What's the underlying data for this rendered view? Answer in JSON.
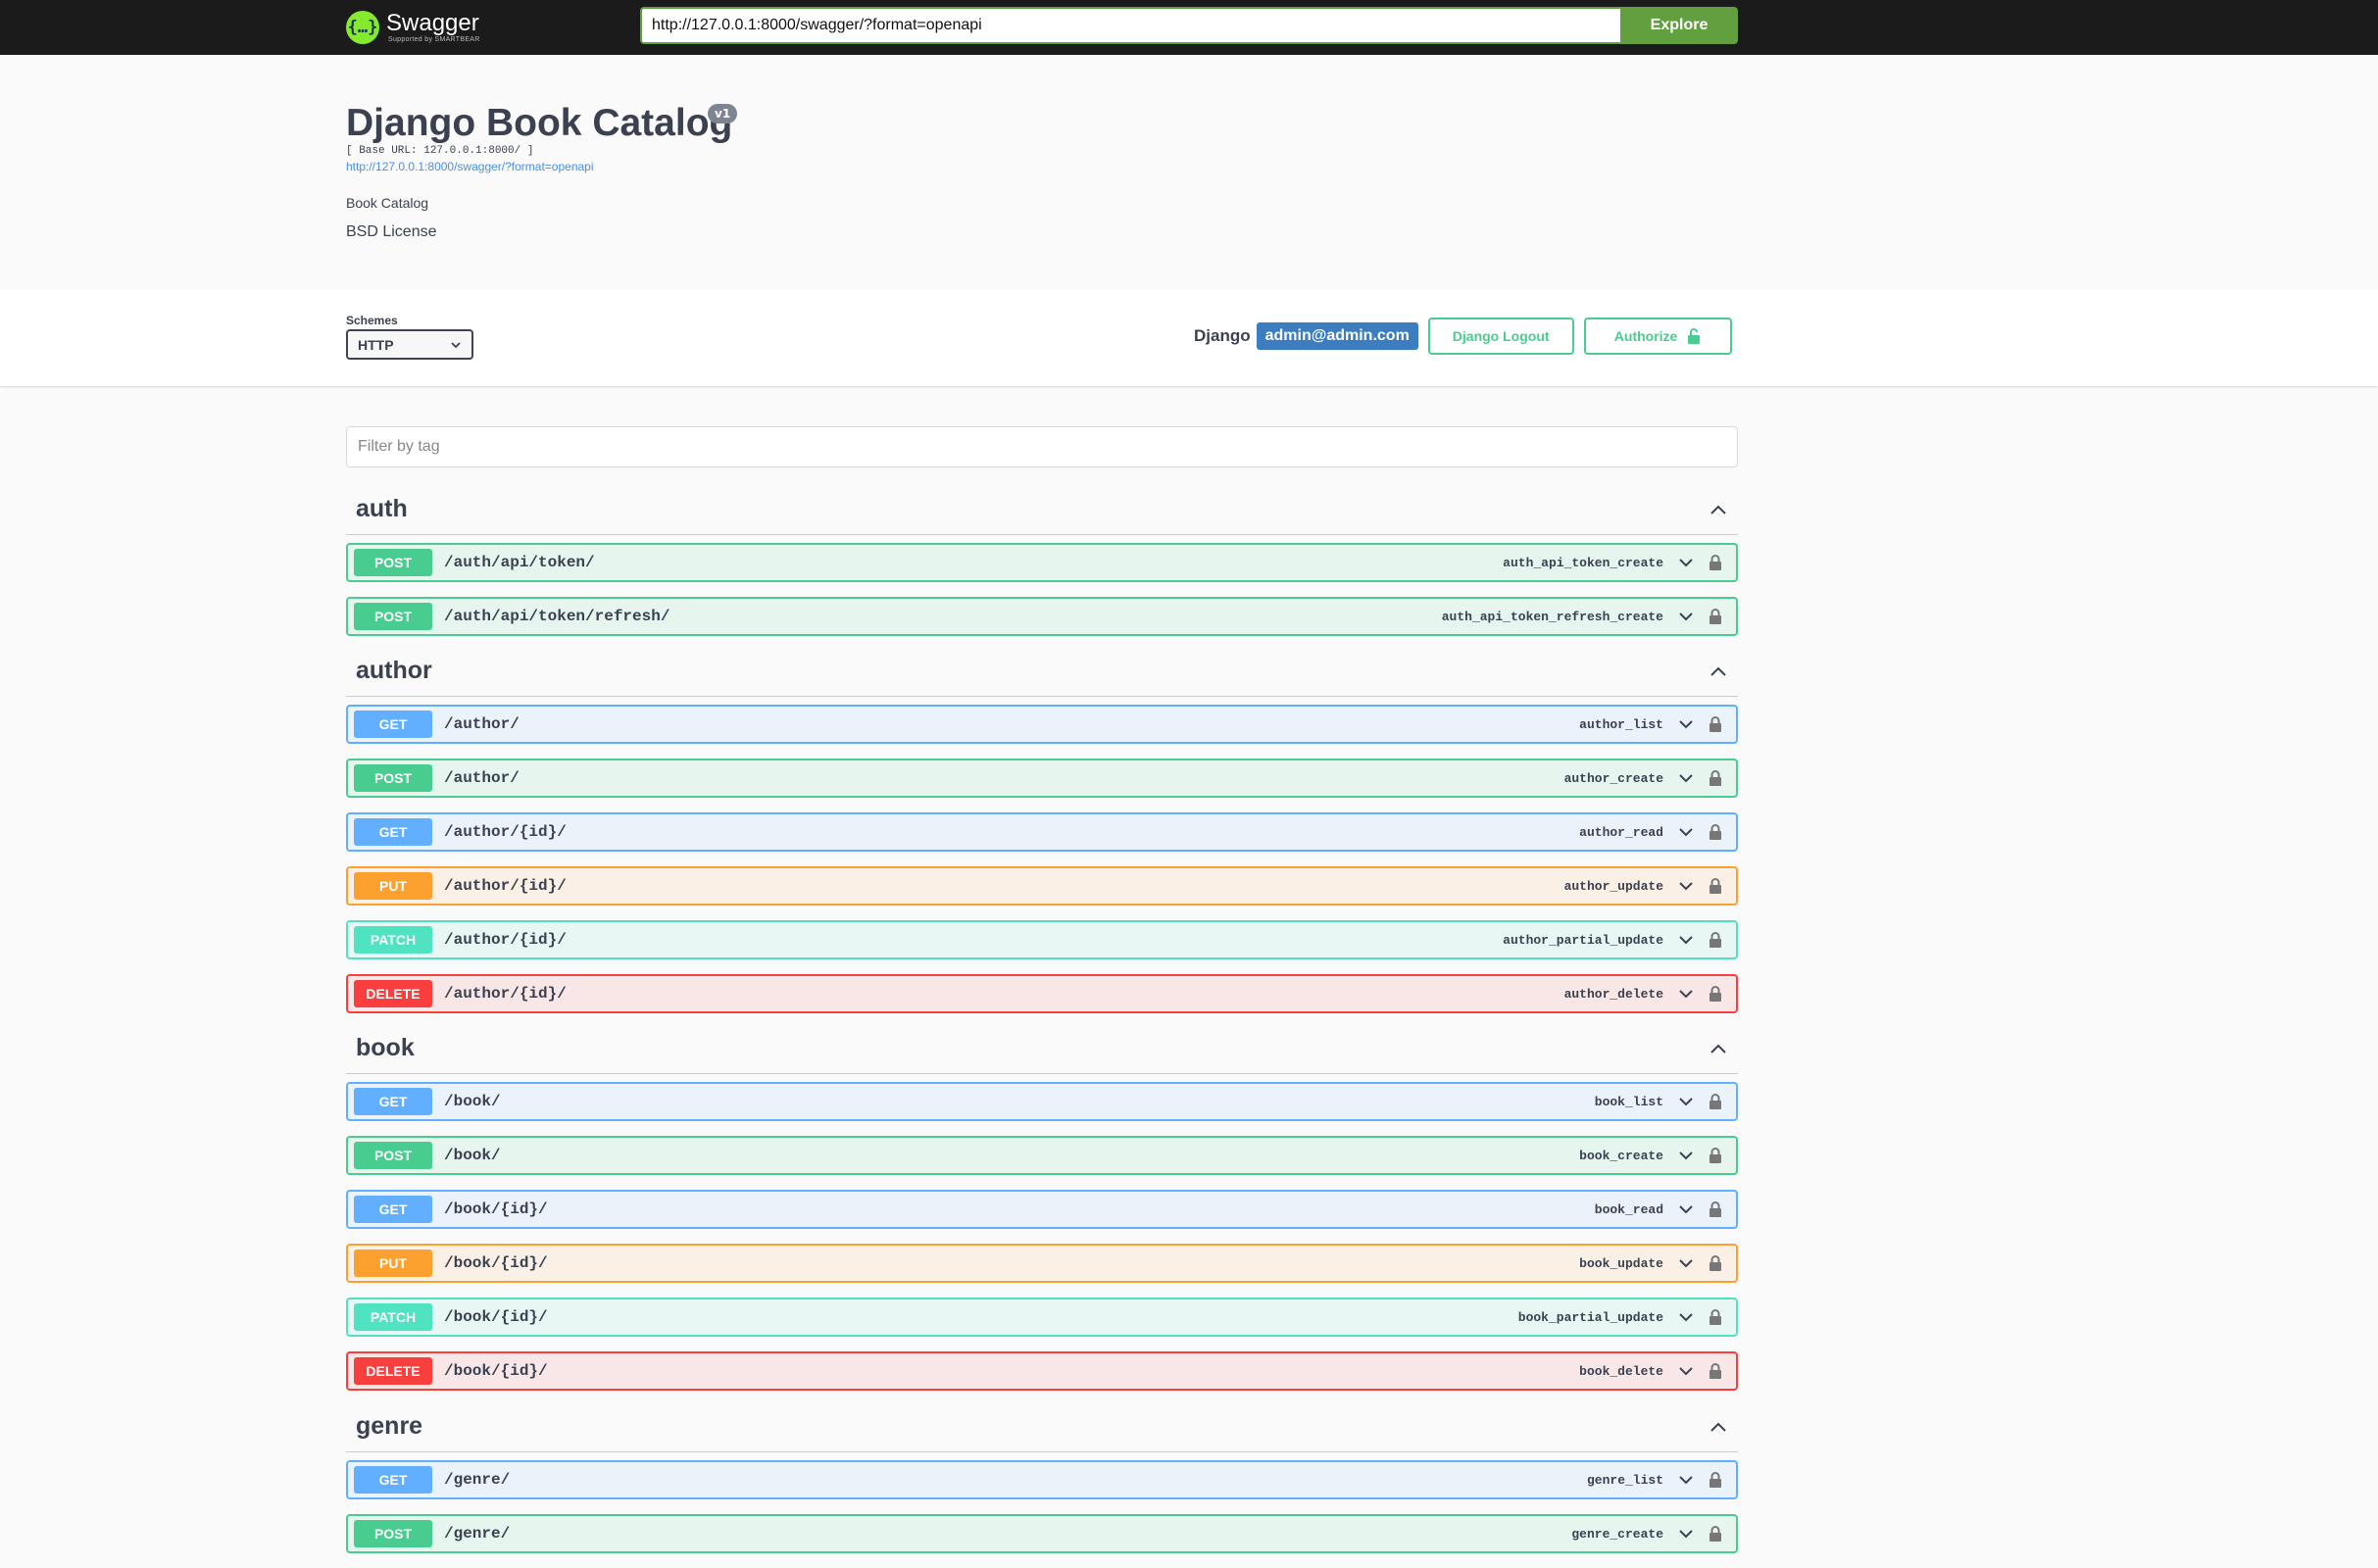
{
  "topbar": {
    "brand": "Swagger",
    "brand_sub": "Supported by SMARTBEAR",
    "url_value": "http://127.0.0.1:8000/swagger/?format=openapi",
    "explore_label": "Explore"
  },
  "info": {
    "title": "Django Book Catalog",
    "version": "v1",
    "base_url": "[ Base URL: 127.0.0.1:8000/ ]",
    "spec_link": "http://127.0.0.1:8000/swagger/?format=openapi",
    "description": "Book Catalog",
    "license": "BSD License"
  },
  "schemes": {
    "label": "Schemes",
    "selected": "HTTP"
  },
  "auth": {
    "django_label": "Django",
    "user": "admin@admin.com",
    "logout_label": "Django Logout",
    "authorize_label": "Authorize"
  },
  "filter": {
    "placeholder": "Filter by tag"
  },
  "colors": {
    "post": "#49cc90",
    "get": "#61affe",
    "put": "#fca130",
    "patch": "#50e3c2",
    "delete": "#f93e3e"
  },
  "sections": [
    {
      "tag": "auth",
      "ops": [
        {
          "method": "POST",
          "path": "/auth/api/token/",
          "op_id": "auth_api_token_create"
        },
        {
          "method": "POST",
          "path": "/auth/api/token/refresh/",
          "op_id": "auth_api_token_refresh_create"
        }
      ]
    },
    {
      "tag": "author",
      "ops": [
        {
          "method": "GET",
          "path": "/author/",
          "op_id": "author_list"
        },
        {
          "method": "POST",
          "path": "/author/",
          "op_id": "author_create"
        },
        {
          "method": "GET",
          "path": "/author/{id}/",
          "op_id": "author_read"
        },
        {
          "method": "PUT",
          "path": "/author/{id}/",
          "op_id": "author_update"
        },
        {
          "method": "PATCH",
          "path": "/author/{id}/",
          "op_id": "author_partial_update"
        },
        {
          "method": "DELETE",
          "path": "/author/{id}/",
          "op_id": "author_delete"
        }
      ]
    },
    {
      "tag": "book",
      "ops": [
        {
          "method": "GET",
          "path": "/book/",
          "op_id": "book_list"
        },
        {
          "method": "POST",
          "path": "/book/",
          "op_id": "book_create"
        },
        {
          "method": "GET",
          "path": "/book/{id}/",
          "op_id": "book_read"
        },
        {
          "method": "PUT",
          "path": "/book/{id}/",
          "op_id": "book_update"
        },
        {
          "method": "PATCH",
          "path": "/book/{id}/",
          "op_id": "book_partial_update"
        },
        {
          "method": "DELETE",
          "path": "/book/{id}/",
          "op_id": "book_delete"
        }
      ]
    },
    {
      "tag": "genre",
      "ops": [
        {
          "method": "GET",
          "path": "/genre/",
          "op_id": "genre_list"
        },
        {
          "method": "POST",
          "path": "/genre/",
          "op_id": "genre_create"
        }
      ]
    }
  ]
}
